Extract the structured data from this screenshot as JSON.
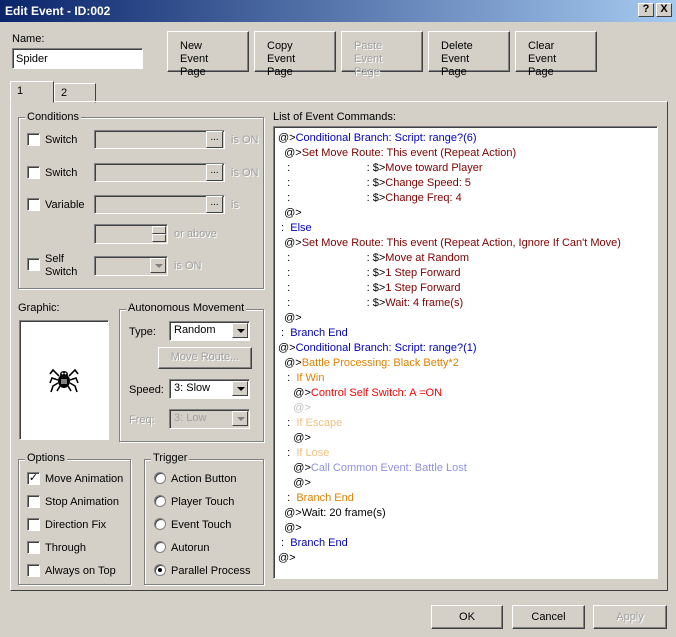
{
  "window": {
    "title": "Edit Event - ID:002",
    "help_label": "?",
    "close_label": "X"
  },
  "name_field": {
    "label": "Name:",
    "value": "Spider"
  },
  "page_buttons": [
    {
      "label": "New\nEvent Page",
      "enabled": true
    },
    {
      "label": "Copy\nEvent Page",
      "enabled": true
    },
    {
      "label": "Paste\nEvent Page",
      "enabled": false
    },
    {
      "label": "Delete\nEvent Page",
      "enabled": true
    },
    {
      "label": "Clear\nEvent Page",
      "enabled": true
    }
  ],
  "tabs": [
    {
      "label": "1",
      "active": true
    },
    {
      "label": "2",
      "active": false
    }
  ],
  "conditions": {
    "title": "Conditions",
    "switch1_label": "Switch",
    "switch1_suffix": "is ON",
    "switch2_label": "Switch",
    "switch2_suffix": "is ON",
    "variable_label": "Variable",
    "variable_suffix": "is",
    "above_suffix": "or above",
    "self_switch_label": "Self\nSwitch",
    "self_switch_suffix": "is ON",
    "dots": "..."
  },
  "graphic": {
    "label": "Graphic:"
  },
  "autonomous": {
    "title": "Autonomous Movement",
    "type_label": "Type:",
    "type_value": "Random",
    "move_route_label": "Move Route...",
    "speed_label": "Speed:",
    "speed_value": "3: Slow",
    "freq_label": "Freq:",
    "freq_value": "3: Low"
  },
  "options": {
    "title": "Options",
    "items": [
      {
        "label": "Move Animation",
        "checked": true
      },
      {
        "label": "Stop Animation",
        "checked": false
      },
      {
        "label": "Direction Fix",
        "checked": false
      },
      {
        "label": "Through",
        "checked": false
      },
      {
        "label": "Always on Top",
        "checked": false
      }
    ],
    "check_mark": "✓"
  },
  "trigger": {
    "title": "Trigger",
    "items": [
      {
        "label": "Action Button",
        "selected": false
      },
      {
        "label": "Player Touch",
        "selected": false
      },
      {
        "label": "Event Touch",
        "selected": false
      },
      {
        "label": "Autorun",
        "selected": false
      },
      {
        "label": "Parallel Process",
        "selected": true
      }
    ]
  },
  "commands": {
    "title": "List of Event Commands:",
    "lines": [
      {
        "prefix": "@>",
        "text": "Conditional Branch: Script: range?(6)",
        "color": "blue",
        "indent": 0
      },
      {
        "prefix": "  @>",
        "text": "Set Move Route: This event (Repeat Action)",
        "color": "route",
        "indent": 0
      },
      {
        "prefix": "   :                         : $>",
        "text": "Move toward Player",
        "color": "route",
        "indent": 0
      },
      {
        "prefix": "   :                         : $>",
        "text": "Change Speed: 5",
        "color": "route",
        "indent": 0
      },
      {
        "prefix": "   :                         : $>",
        "text": "Change Freq: 4",
        "color": "route",
        "indent": 0
      },
      {
        "prefix": "  @>",
        "text": "",
        "color": "normal",
        "indent": 0
      },
      {
        "prefix": " :  ",
        "text": "Else",
        "color": "blue",
        "indent": 0
      },
      {
        "prefix": "  @>",
        "text": "Set Move Route: This event (Repeat Action, Ignore If Can't Move)",
        "color": "route",
        "indent": 0
      },
      {
        "prefix": "   :                         : $>",
        "text": "Move at Random",
        "color": "route",
        "indent": 0
      },
      {
        "prefix": "   :                         : $>",
        "text": "1 Step Forward",
        "color": "route",
        "indent": 0
      },
      {
        "prefix": "   :                         : $>",
        "text": "1 Step Forward",
        "color": "route",
        "indent": 0
      },
      {
        "prefix": "   :                         : $>",
        "text": "Wait: 4 frame(s)",
        "color": "route",
        "indent": 0
      },
      {
        "prefix": "  @>",
        "text": "",
        "color": "normal",
        "indent": 0
      },
      {
        "prefix": " :  ",
        "text": "Branch End",
        "color": "blue",
        "indent": 0
      },
      {
        "prefix": "@>",
        "text": "Conditional Branch: Script: range?(1)",
        "color": "blue",
        "indent": 0
      },
      {
        "prefix": "  @>",
        "text": "Battle Processing: Black Betty*2",
        "color": "battle",
        "indent": 0
      },
      {
        "prefix": "   :  ",
        "text": "If Win",
        "color": "battle",
        "indent": 0
      },
      {
        "prefix": "     @>",
        "text": "Control Self Switch: A =ON",
        "color": "red",
        "indent": 0
      },
      {
        "prefix": "     @>",
        "text": "",
        "color": "light",
        "indent": 0
      },
      {
        "prefix": "   :  ",
        "text": "If Escape",
        "color": "lightorange",
        "indent": 0
      },
      {
        "prefix": "     @>",
        "text": "",
        "color": "normal",
        "indent": 0
      },
      {
        "prefix": "   :  ",
        "text": "If Lose",
        "color": "lightorange",
        "indent": 0
      },
      {
        "prefix": "     @>",
        "text": "Call Common Event: Battle Lost",
        "color": "lightblue",
        "indent": 0
      },
      {
        "prefix": "     @>",
        "text": "",
        "color": "normal",
        "indent": 0
      },
      {
        "prefix": "   :  ",
        "text": "Branch End",
        "color": "battle",
        "indent": 0
      },
      {
        "prefix": "  @>",
        "text": "Wait: 20 frame(s)",
        "color": "normal",
        "indent": 0
      },
      {
        "prefix": "  @>",
        "text": "",
        "color": "normal",
        "indent": 0
      },
      {
        "prefix": " :  ",
        "text": "Branch End",
        "color": "blue",
        "indent": 0
      },
      {
        "prefix": "@>",
        "text": "",
        "color": "normal",
        "indent": 0
      }
    ]
  },
  "footer": {
    "ok_label": "OK",
    "cancel_label": "Cancel",
    "apply_label": "Apply"
  },
  "colors": {
    "title_gradient_start": "#0a246a",
    "title_gradient_end": "#a6caf0",
    "face": "#d4d0c8",
    "command_blue": "#0000c0",
    "command_route": "#800000",
    "command_battle": "#e08000",
    "command_red": "#ff0000"
  }
}
